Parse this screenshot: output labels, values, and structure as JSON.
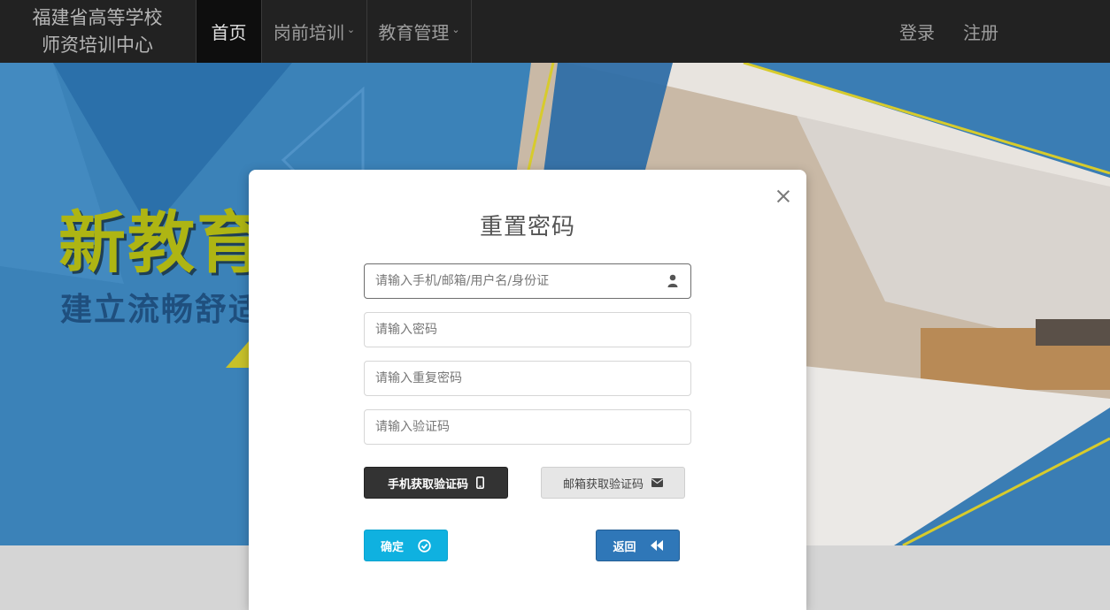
{
  "brand": {
    "line1": "福建省高等学校",
    "line2": "师资培训中心"
  },
  "nav": {
    "home": "首页",
    "training": "岗前培训",
    "management": "教育管理",
    "caret": "⌄",
    "login": "登录",
    "register": "注册"
  },
  "hero": {
    "title": "新教育",
    "subtitle": "建立流畅舒适"
  },
  "modal": {
    "title": "重置密码",
    "fields": {
      "account_placeholder": "请输入手机/邮箱/用户名/身份证",
      "password_placeholder": "请输入密码",
      "repeat_placeholder": "请输入重复密码",
      "code_placeholder": "请输入验证码"
    },
    "buttons": {
      "phone_code": "手机获取验证码",
      "email_code": "邮箱获取验证码",
      "confirm": "确定",
      "back": "返回"
    },
    "icons": {
      "account": "user-icon",
      "phone": "mobile-icon",
      "email": "envelope-icon",
      "confirm": "check-circle-icon",
      "back": "backward-icon",
      "close": "close-icon"
    }
  },
  "colors": {
    "navbar": "#222222",
    "confirm": "#0fb1e0",
    "back": "#2f77b8",
    "phone_button": "#333333",
    "hero_title": "#aeb513"
  }
}
